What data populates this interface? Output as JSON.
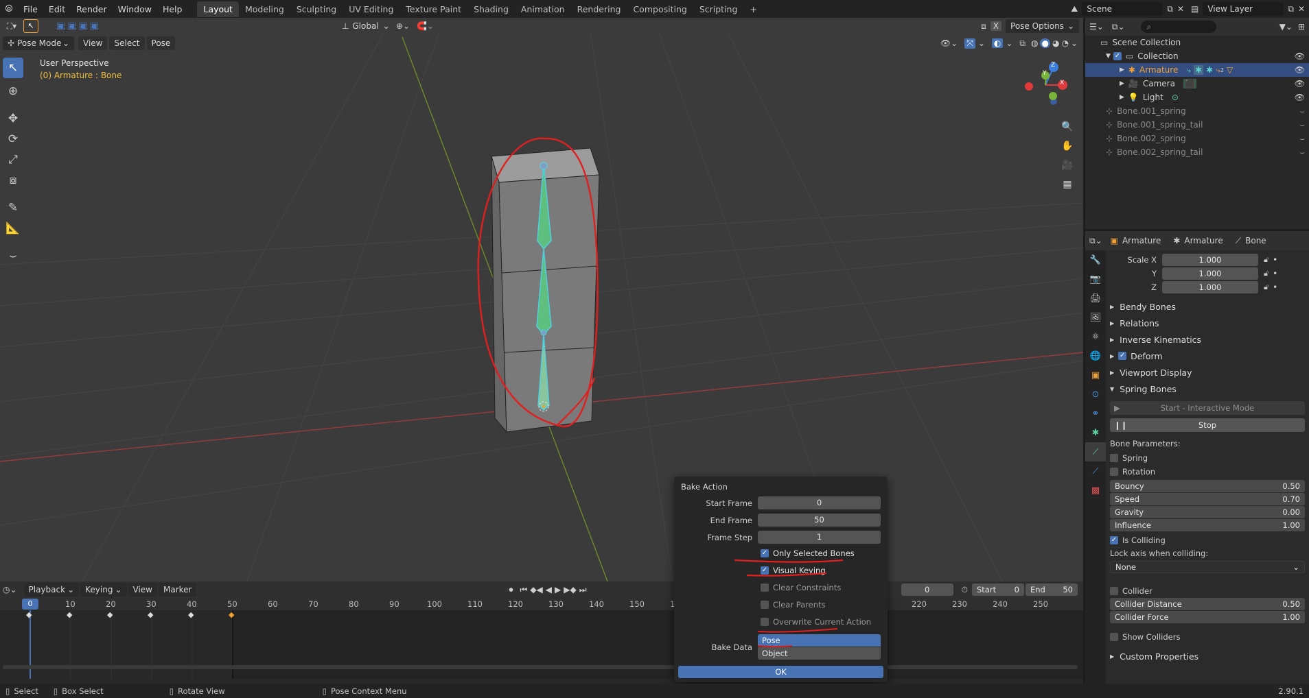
{
  "topbar": {
    "menus": [
      "File",
      "Edit",
      "Render",
      "Window",
      "Help"
    ],
    "tabs": [
      "Layout",
      "Modeling",
      "Sculpting",
      "UV Editing",
      "Texture Paint",
      "Shading",
      "Animation",
      "Rendering",
      "Compositing",
      "Scripting"
    ],
    "add_tab": "+",
    "scene": "Scene",
    "view_layer": "View Layer"
  },
  "viewport": {
    "mode": "Pose Mode",
    "menus": [
      "View",
      "Select",
      "Pose"
    ],
    "orientation": "Global",
    "pose_options": "Pose Options",
    "overlay_title": "User Perspective",
    "overlay_sub": "(0) Armature : Bone",
    "gizmo": {
      "x": "X",
      "y": "Y",
      "z": "Z"
    }
  },
  "outliner": {
    "root": "Scene Collection",
    "collection": "Collection",
    "items": [
      "Armature",
      "Camera",
      "Light"
    ],
    "orphans": [
      "Bone.001_spring",
      "Bone.001_spring_tail",
      "Bone.002_spring",
      "Bone.002_spring_tail"
    ],
    "armature_badge": "2"
  },
  "properties": {
    "breadcrumb": [
      "Armature",
      "Armature",
      "Bone"
    ],
    "scale_label": "Scale X",
    "scale_y": "Y",
    "scale_z": "Z",
    "scale_values": [
      "1.000",
      "1.000",
      "1.000"
    ],
    "panels": [
      "Bendy Bones",
      "Relations",
      "Inverse Kinematics",
      "Deform",
      "Viewport Display",
      "Spring Bones"
    ],
    "start_btn": "Start - Interactive Mode",
    "stop_btn": "Stop",
    "bone_params": "Bone Parameters:",
    "spring": "Spring",
    "rotation": "Rotation",
    "bouncy": {
      "label": "Bouncy",
      "value": "0.50"
    },
    "speed": {
      "label": "Speed",
      "value": "0.70"
    },
    "gravity": {
      "label": "Gravity",
      "value": "0.00"
    },
    "influence": {
      "label": "Influence",
      "value": "1.00"
    },
    "is_colliding": "Is Colliding",
    "lock_axis": "Lock axis when colliding:",
    "lock_axis_value": "None",
    "collider": "Collider",
    "collider_distance": {
      "label": "Collider Distance",
      "value": "0.50"
    },
    "collider_force": {
      "label": "Collider Force",
      "value": "1.00"
    },
    "show_colliders": "Show Colliders",
    "custom_props": "Custom Properties"
  },
  "timeline": {
    "menus": [
      "Playback",
      "Keying",
      "View",
      "Marker"
    ],
    "current_frame": "0",
    "start_label": "Start",
    "start": "0",
    "end_label": "End",
    "end": "50",
    "frame_field": "0",
    "ticks": [
      "0",
      "10",
      "20",
      "30",
      "40",
      "50",
      "60",
      "70",
      "80",
      "90",
      "100",
      "110",
      "120",
      "130",
      "140",
      "150",
      "1",
      "220",
      "230",
      "240",
      "250"
    ]
  },
  "bake": {
    "title": "Bake Action",
    "start_frame": {
      "label": "Start Frame",
      "value": "0"
    },
    "end_frame": {
      "label": "End Frame",
      "value": "50"
    },
    "frame_step": {
      "label": "Frame Step",
      "value": "1"
    },
    "checks": [
      {
        "label": "Only Selected Bones",
        "on": true
      },
      {
        "label": "Visual Keying",
        "on": true
      },
      {
        "label": "Clear Constraints",
        "on": false
      },
      {
        "label": "Clear Parents",
        "on": false
      },
      {
        "label": "Overwrite Current Action",
        "on": false
      }
    ],
    "bake_data_label": "Bake Data",
    "bake_data": [
      "Pose",
      "Object"
    ],
    "ok": "OK"
  },
  "status": {
    "select": "Select",
    "box_select": "Box Select",
    "rotate": "Rotate View",
    "context": "Pose Context Menu",
    "version": "2.90.1"
  },
  "colors": {
    "accent": "#4772b3",
    "annotation": "#e01f1f",
    "bone": "#5fbf7f",
    "keyframe_active": "#f0a030"
  }
}
